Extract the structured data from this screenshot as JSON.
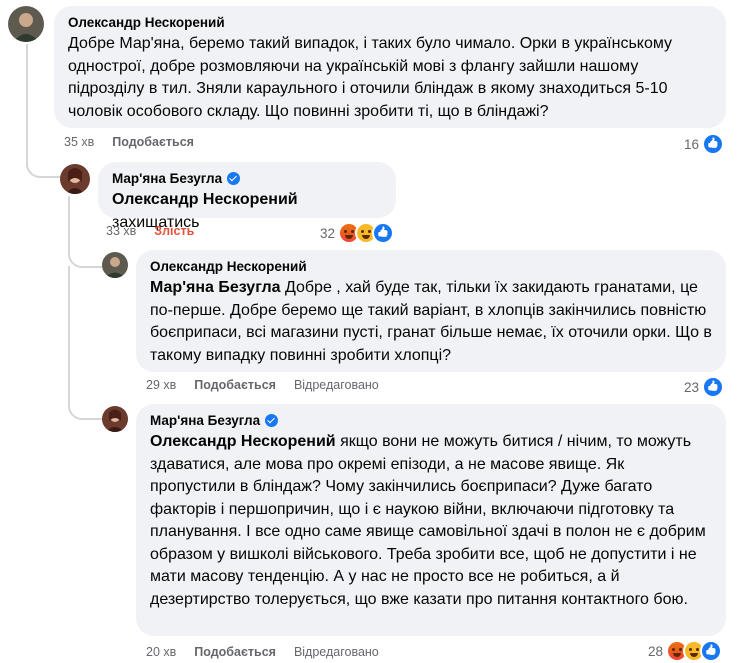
{
  "comments": [
    {
      "author": "Олександр Нескорений",
      "verified": false,
      "mention": "",
      "text": "Добре Мар'яна, беремо такий випадок, і таких було чимало. Орки в українському однострої, добре розмовляючи на українській мові з флангу зайшли нашому підрозділу в тил. Зняли караульного і оточили бліндаж в якому знаходиться 5-10 чоловік особового складу. Що повинні зробити ті, що в бліндажі?",
      "time": "35 хв",
      "action": "Подобається",
      "edited": "",
      "reaction_count": "16",
      "reaction_icons": [
        "like-icon"
      ]
    },
    {
      "author": "Мар'яна Безугла",
      "verified": true,
      "mention": "Олександр Нескорений",
      "text": " захищатись",
      "time": "33 хв",
      "action": "Злість",
      "edited": "",
      "reaction_count": "32",
      "reaction_icons": [
        "angry-icon",
        "haha-icon",
        "like-icon"
      ]
    },
    {
      "author": "Олександр Нескорений",
      "verified": false,
      "mention": "Мар'яна Безугла",
      "text": " Добре , хай буде так, тільки їх закидають гранатами, це по-перше. Добре беремо ще такий варіант, в хлопців закінчились повністю боєприпаси, всі магазини пусті, гранат більше немає, їх оточили орки. Що в такому випадку повинні зробити хлопці?",
      "time": "29 хв",
      "action": "Подобається",
      "edited": "Відредаговано",
      "reaction_count": "23",
      "reaction_icons": [
        "like-icon"
      ]
    },
    {
      "author": "Мар'яна Безугла",
      "verified": true,
      "mention": "Олександр Нескорений",
      "text": " якщо вони не можуть битися / нічим, то можуть здаватися, але мова про окремі епізоди, а не масове явище. Як пропустили в бліндаж? Чому закінчились боєприпаси? Дуже багато факторів і першопричин, що і є наукою війни, включаючи підготовку та планування. І все одно саме явище самовільної здачі в полон не є добрим образом у вишколі військового. Треба зробити все, щоб не допустити і не мати масову тенденцію. А у нас не просто все не робиться, а й дезертирство толерується, що вже казати про питання контактного бою.",
      "time": "20 хв",
      "action": "Подобається",
      "edited": "Відредаговано",
      "reaction_count": "28",
      "reaction_icons": [
        "angry-icon",
        "haha-icon",
        "like-icon"
      ]
    }
  ]
}
